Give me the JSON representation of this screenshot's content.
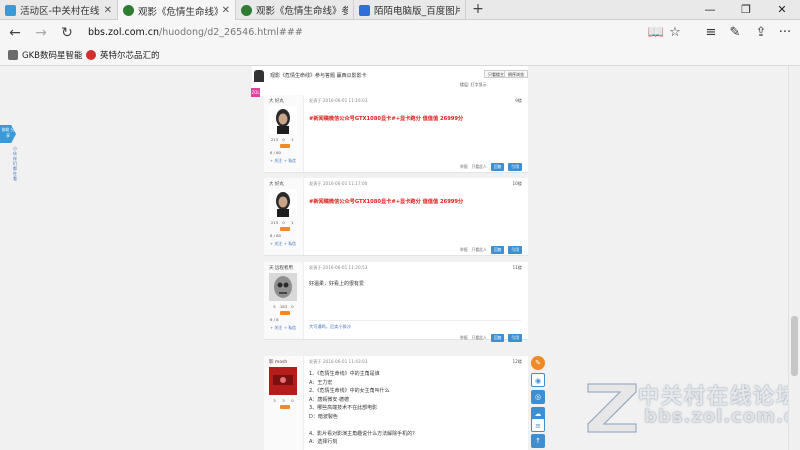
{
  "browser": {
    "tabs": [
      {
        "title": "活动区-中关村在线论坛#c",
        "icon": "zol-icon",
        "active": false
      },
      {
        "title": "观影《危情生命线》参与",
        "icon": "film-icon",
        "active": true
      },
      {
        "title": "观影《危情生命线》参与答",
        "icon": "film-icon",
        "active": false
      },
      {
        "title": "陌陌电脑版_百度图片搜索",
        "icon": "baidu-icon",
        "active": false
      }
    ],
    "new_tab_glyph": "+",
    "window_controls": {
      "minimize": "—",
      "restore": "❐",
      "close": "✕"
    },
    "nav": {
      "back": "←",
      "forward": "→",
      "refresh": "↻"
    },
    "url": {
      "domain": "bbs.zol.com.cn",
      "path": "/huodong/d2_26546.html###"
    },
    "toolbar": {
      "reading": "📖",
      "favorite": "☆",
      "hub": "≡",
      "notes": "✎",
      "share": "⇪",
      "more": "···"
    },
    "favorites": [
      {
        "label": "GKB数码星智能",
        "color": "#6b6b6b"
      },
      {
        "label": "英特尔芯品汇的",
        "color": "#d32f2f"
      }
    ]
  },
  "thread": {
    "header_title": "观影《危情生命线》参与答题 赢西瓜影影卡",
    "header_buttons": [
      "只看楼主",
      "倒序浏览"
    ],
    "header_sub": "楼层: 打字显示"
  },
  "posts": [
    {
      "user": "大 好丸",
      "date": "发表于 2016-06-01 11:16:03",
      "floor": "9楼",
      "stats": [
        "213",
        "0",
        "1"
      ],
      "stats2": "6 / 80",
      "links": [
        "+ 关注",
        "+ 私信"
      ],
      "body_red": "#新闻稿微信公众号GTX1080显卡#+显卡跑分 值值值 26999分",
      "actions": [
        "举报",
        "只看此人",
        "回复",
        "引用"
      ]
    },
    {
      "user": "大 好丸",
      "date": "发表于 2016-06-01 11:17:00",
      "floor": "10楼",
      "stats": [
        "213",
        "0",
        "1"
      ],
      "stats2": "6 / 80",
      "links": [
        "+ 关注",
        "+ 私信"
      ],
      "body_red": "#新闻稿微信公众号GTX1080显卡#+显卡跑分 值值值 26999分",
      "actions": [
        "举报",
        "只看此人",
        "回复",
        "引用"
      ]
    },
    {
      "user": "天 远程者用",
      "date": "发表于 2016-06-01 11:20:53",
      "floor": "11楼",
      "stats": [
        "5",
        "183",
        "0"
      ],
      "stats2": "6 / 8",
      "links": [
        "+ 关注",
        "+ 私信"
      ],
      "body": "好温柔，好看上的很有爱",
      "signature": "大写通鸣，后卖小排沙",
      "actions": [
        "举报",
        "只看此人",
        "回复",
        "引用"
      ]
    },
    {
      "user": "影 mosh",
      "date": "发表于 2016-06-01 11:43:03",
      "floor": "12楼",
      "stats": [
        "3",
        "3",
        "0"
      ],
      "stats2": "",
      "links": [],
      "lines": [
        "1、《危情生命线》中的主角是谁",
        "A：王力宏",
        "2、《危情生命线》中的女主角叫什么",
        "A：唐嫣微安·德德",
        "3、哪些高端技术不在此部电影",
        "D：暗波製色",
        "",
        "4、影片看对影演主角趣说什么方法解除手机的？",
        "A：选择行刻"
      ]
    }
  ],
  "floating": {
    "left_tab": "协助 分享",
    "left_vertical": "小伙伴们都在看",
    "share_icons": [
      "reply-icon",
      "wechat-icon",
      "weibo-icon",
      "chat-icon",
      "list-icon",
      "top-icon"
    ]
  },
  "watermark": {
    "cn": "中关村在线论坛",
    "en": "bbs.zol.com.cn"
  }
}
